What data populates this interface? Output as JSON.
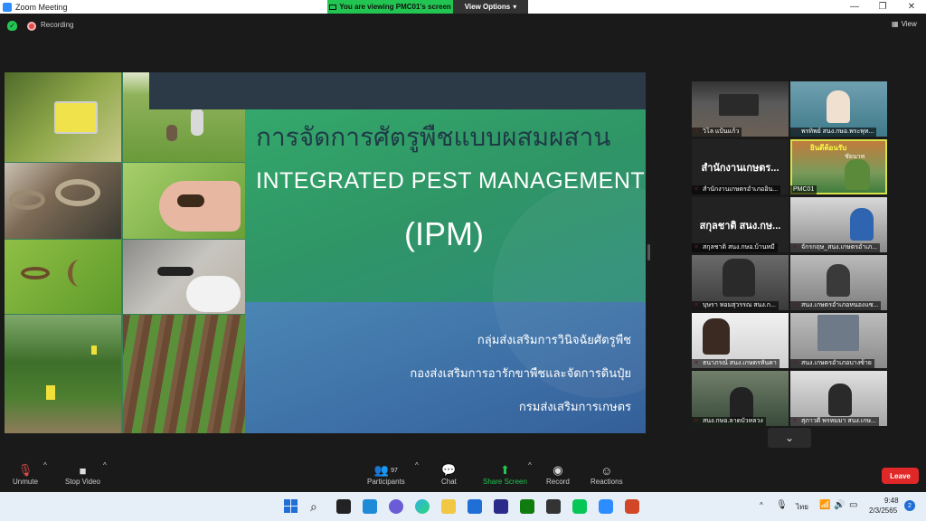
{
  "window": {
    "title": "Zoom Meeting",
    "minimize_glyph": "—",
    "maximize_glyph": "❐",
    "close_glyph": "✕"
  },
  "banner": {
    "viewing_text": "You are viewing PMC01's screen",
    "view_options": "View Options"
  },
  "meeting": {
    "recording_label": "Recording",
    "view_label": "View"
  },
  "slide": {
    "title_thai": "การจัดการศัตรูพืชแบบผสมผสาน",
    "title_english": "INTEGRATED PEST MANAGEMENT",
    "title_abbr": "(IPM)",
    "line1": "กลุ่มส่งเสริมการวินิจฉัยศัตรูพืช",
    "line2": "กองส่งเสริมการอารักขาพืชและจัดการดินปุ๋ย",
    "line3": "กรมส่งเสริมการเกษตร"
  },
  "participants_tiles": [
    {
      "name": "วิโล แป้นแก้ว"
    },
    {
      "name": "พรทิพย์ สนง.กษอ.พระพุท..."
    },
    {
      "name": "สำนักงานเกษตรอำเภออิน...",
      "big_name": "สำนักงานเกษตร..."
    },
    {
      "name": "PMC01"
    },
    {
      "name": "สกุลชาติ สนง.กษอ.บ้านหมี่",
      "big_name": "สกุลชาติ สนง.กษ..."
    },
    {
      "name": "จักรกฤษ_สนง.เกษตรอำเภ..."
    },
    {
      "name": "บุษรา หอมสุวรรณ สนง.ก..."
    },
    {
      "name": "สนง.เกษตรอำเภอหนองแซ..."
    },
    {
      "name": "ธนาภรณ์ สนง.เกษตรหันคา"
    },
    {
      "name": "สนง.เกษตรอำเภอบางซ้าย"
    },
    {
      "name": "สนง.กษอ.ลาดบัวหลวง"
    },
    {
      "name": "สุภาวดี พรหมมา สนง.เกษ..."
    }
  ],
  "pmc01_overlay": {
    "line1": "ยินดีต้อนรับ",
    "line2": "ชัยนาท"
  },
  "toolbar": {
    "unmute": "Unmute",
    "stop_video": "Stop Video",
    "participants": "Participants",
    "participants_count": "97",
    "chat": "Chat",
    "share_screen": "Share Screen",
    "record": "Record",
    "reactions": "Reactions",
    "leave": "Leave",
    "caret": "^"
  },
  "taskbar": {
    "time": "9:48",
    "date": "2/3/2565",
    "lang": "ไทย",
    "notif_count": "2",
    "chevron": "^"
  },
  "colors": {
    "accent_green": "#23c552",
    "leave_red": "#e02828",
    "active_speaker": "#d7e24a"
  }
}
